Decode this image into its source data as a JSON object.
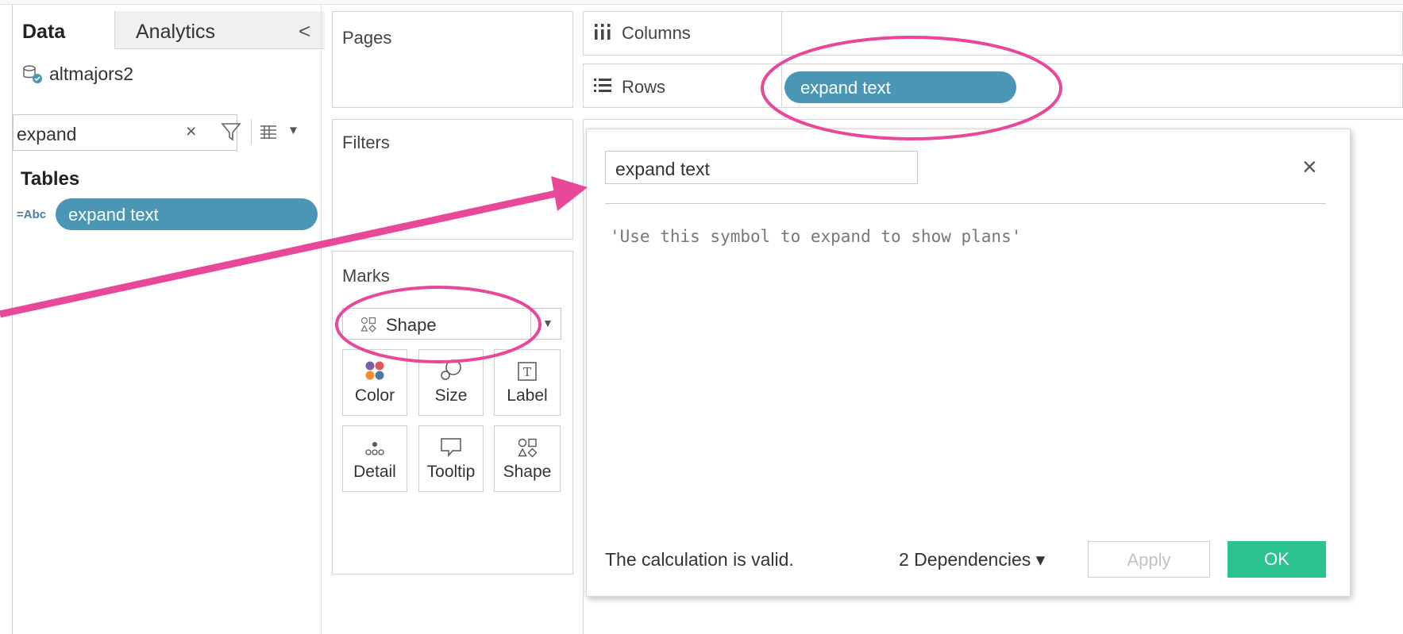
{
  "data_pane": {
    "tabs": [
      "Data",
      "Analytics"
    ],
    "collapse_glyph": "<",
    "datasource": "altmajors2",
    "search_value": "expand",
    "search_clear": "×",
    "tables_heading": "Tables",
    "field_type": "=Abc",
    "field_name": "expand text"
  },
  "shelves": {
    "pages": "Pages",
    "filters": "Filters",
    "columns": "Columns",
    "rows": "Rows",
    "rows_pill": "expand text"
  },
  "marks": {
    "title": "Marks",
    "mark_type": "Shape",
    "cards": [
      "Color",
      "Size",
      "Label",
      "Detail",
      "Tooltip",
      "Shape"
    ]
  },
  "calc_dialog": {
    "name": "expand text",
    "close_glyph": "×",
    "formula": "'Use this symbol to expand to show plans'",
    "status": "The calculation is valid.",
    "dependencies": "2 Dependencies ▾",
    "apply_label": "Apply",
    "ok_label": "OK"
  },
  "annotation": {
    "color": "#e8489a",
    "pill_color": "#4b96b4",
    "ok_color": "#2bc48f"
  }
}
